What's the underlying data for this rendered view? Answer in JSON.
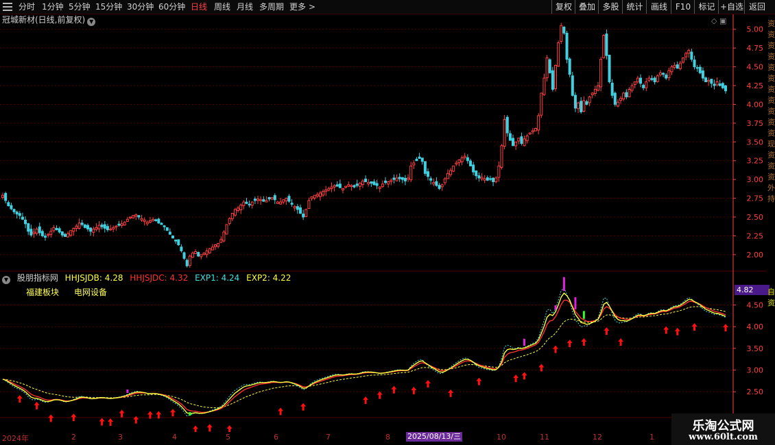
{
  "colors": {
    "up": "#ff4040",
    "down": "#40d0e0",
    "grid": "#5a0000",
    "axis": "#ff4040",
    "hhjsjdb": "#ffff40",
    "hhjsjdc": "#ff3030",
    "exp1": "#40e0e0",
    "exp2": "#ffff40",
    "arrow": "#ff1010",
    "magenta": "#e020e0",
    "green": "#30ff30"
  },
  "toolbar": {
    "periods": [
      "分时",
      "1分钟",
      "5分钟",
      "15分钟",
      "30分钟",
      "60分钟",
      "日线",
      "周线",
      "月线",
      "多周期",
      "更多 >"
    ],
    "active": "日线",
    "tools": [
      "复权",
      "叠加",
      "多股",
      "统计",
      "画线",
      "F10",
      "标记",
      "+自选",
      "返回"
    ]
  },
  "stock": {
    "title": "冠城新材(日线,前复权)"
  },
  "indicator": {
    "name": "股朋指标网",
    "hhjsjdb": "HHJSJDB: 4.28",
    "hhjsjdc": "HHJSJDC: 4.32",
    "exp1": "EXP1: 4.24",
    "exp2": "EXP2: 4.22",
    "sector1": "福建板块",
    "sector2": "电网设备",
    "price_tag": "4.82"
  },
  "right_panel": {
    "text_upper": "资资资资资资资资资资资现资资资外持",
    "text_lower": "自资"
  },
  "xaxis": {
    "labels": [
      "2024年",
      "2",
      "3",
      "4",
      "5",
      "6",
      "7",
      "8",
      "10",
      "11",
      "12",
      "1"
    ],
    "highlight": "2025/08/13/三"
  },
  "watermark": {
    "line1": "乐淘公式网",
    "line2": "www.60lt.com"
  },
  "chart_data": {
    "type": "candlestick",
    "price_axis": {
      "ticks": [
        "5.00",
        "4.75",
        "4.50",
        "4.25",
        "4.00",
        "3.75",
        "3.50",
        "3.25",
        "3.00",
        "2.75",
        "2.50",
        "2.25",
        "2.00"
      ],
      "range": [
        1.78,
        5.18
      ]
    },
    "indicator_axis": {
      "ticks": [
        "4.50",
        "4.00",
        "3.50",
        "3.00",
        "2.50"
      ],
      "range": [
        1.92,
        4.95
      ]
    },
    "close": [
      2.79,
      2.72,
      2.65,
      2.61,
      2.57,
      2.54,
      2.52,
      2.47,
      2.41,
      2.31,
      2.26,
      2.3,
      2.34,
      2.29,
      2.25,
      2.23,
      2.27,
      2.31,
      2.36,
      2.33,
      2.3,
      2.26,
      2.24,
      2.28,
      2.32,
      2.35,
      2.38,
      2.42,
      2.4,
      2.36,
      2.34,
      2.31,
      2.34,
      2.36,
      2.39,
      2.37,
      2.35,
      2.33,
      2.34,
      2.36,
      2.38,
      2.39,
      2.41,
      2.43,
      2.47,
      2.5,
      2.52,
      2.53,
      2.5,
      2.48,
      2.46,
      2.43,
      2.45,
      2.47,
      2.45,
      2.42,
      2.4,
      2.37,
      2.32,
      2.27,
      2.22,
      2.18,
      2.13,
      2.05,
      1.95,
      1.85,
      1.98,
      2.02,
      2.04,
      1.98,
      2.0,
      2.02,
      2.05,
      2.08,
      2.1,
      2.13,
      2.15,
      2.2,
      2.3,
      2.4,
      2.48,
      2.55,
      2.6,
      2.62,
      2.66,
      2.7,
      2.68,
      2.66,
      2.7,
      2.72,
      2.74,
      2.73,
      2.71,
      2.72,
      2.74,
      2.76,
      2.73,
      2.7,
      2.7,
      2.73,
      2.75,
      2.71,
      2.67,
      2.64,
      2.6,
      2.55,
      2.5,
      2.6,
      2.72,
      2.77,
      2.79,
      2.8,
      2.82,
      2.84,
      2.86,
      2.88,
      2.9,
      2.92,
      2.91,
      2.89,
      2.88,
      2.91,
      2.93,
      2.92,
      2.9,
      2.92,
      2.95,
      2.98,
      2.97,
      2.96,
      2.95,
      2.93,
      2.92,
      2.9,
      2.94,
      2.96,
      2.97,
      2.99,
      3.0,
      3.02,
      3.01,
      3.0,
      2.98,
      3.02,
      3.18,
      3.22,
      3.25,
      3.28,
      3.24,
      3.08,
      3.04,
      2.99,
      2.96,
      2.92,
      2.88,
      2.93,
      3.01,
      3.08,
      3.12,
      3.18,
      3.22,
      3.26,
      3.29,
      3.31,
      3.25,
      3.18,
      3.1,
      3.05,
      3.02,
      3.03,
      3.01,
      2.99,
      3.0,
      2.97,
      3.02,
      3.18,
      3.45,
      3.8,
      3.62,
      3.52,
      3.45,
      3.5,
      3.55,
      3.48,
      3.54,
      3.58,
      3.62,
      3.65,
      3.68,
      3.85,
      4.15,
      4.35,
      4.62,
      4.42,
      4.2,
      4.52,
      4.82,
      5.05,
      4.95,
      4.6,
      4.4,
      4.12,
      3.95,
      4.02,
      3.9,
      4.05,
      4.0,
      4.1,
      4.15,
      4.2,
      4.25,
      4.6,
      4.92,
      4.65,
      4.3,
      4.12,
      4.0,
      4.03,
      4.08,
      4.15,
      4.1,
      4.2,
      4.25,
      4.3,
      4.35,
      4.28,
      4.22,
      4.3,
      4.35,
      4.33,
      4.3,
      4.38,
      4.42,
      4.4,
      4.35,
      4.45,
      4.5,
      4.52,
      4.48,
      4.55,
      4.62,
      4.68,
      4.72,
      4.6,
      4.5,
      4.48,
      4.42,
      4.35,
      4.3,
      4.32,
      4.28,
      4.25,
      4.3,
      4.25,
      4.22,
      4.18
    ],
    "hhjsjdb_last": 4.28,
    "hhjsjdc_last": 4.32,
    "exp1_last": 4.24,
    "exp2_last": 4.22
  }
}
